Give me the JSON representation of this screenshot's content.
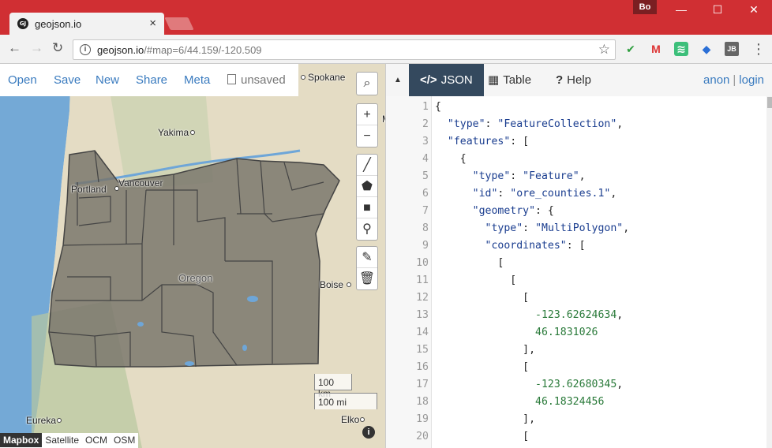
{
  "browser": {
    "tab_title": "geojson.io",
    "tab_favicon": "GJ",
    "profile": "Bo",
    "url_host": "geojson.io",
    "url_rest": "/#map=6/44.159/-120.509"
  },
  "map": {
    "menu": {
      "open": "Open",
      "save": "Save",
      "new": "New",
      "share": "Share",
      "meta": "Meta",
      "unsaved": "unsaved"
    },
    "places": {
      "spokane": "Spokane",
      "yakima": "Yakima",
      "portland": "Portland",
      "vancouver": "Vancouver",
      "oregon": "Oregon",
      "boise": "Boise",
      "eureka": "Eureka",
      "elko": "Elko",
      "m_label": "M"
    },
    "scale_km": "100 km",
    "scale_mi": "100 mi",
    "layers": [
      "Mapbox",
      "Satellite",
      "OCM",
      "OSM"
    ],
    "active_layer": "Mapbox"
  },
  "pane": {
    "tabs": {
      "json": "JSON",
      "table": "Table",
      "help": "Help"
    },
    "anon": "anon",
    "separator": "|",
    "login": "login"
  },
  "code_lines": [
    "{",
    "  \"type\": \"FeatureCollection\",",
    "  \"features\": [",
    "    {",
    "      \"type\": \"Feature\",",
    "      \"id\": \"ore_counties.1\",",
    "      \"geometry\": {",
    "        \"type\": \"MultiPolygon\",",
    "        \"coordinates\": [",
    "          [",
    "            [",
    "              [",
    "                -123.62624634,",
    "                46.1831026",
    "              ],",
    "              [",
    "                -123.62680345,",
    "                46.18324456",
    "              ],",
    "              ["
  ],
  "colors": {
    "chrome_red": "#d02f33",
    "link_blue": "#3a7bbf",
    "json_tab_bg": "#34495e",
    "county_fill": "#77746a"
  }
}
